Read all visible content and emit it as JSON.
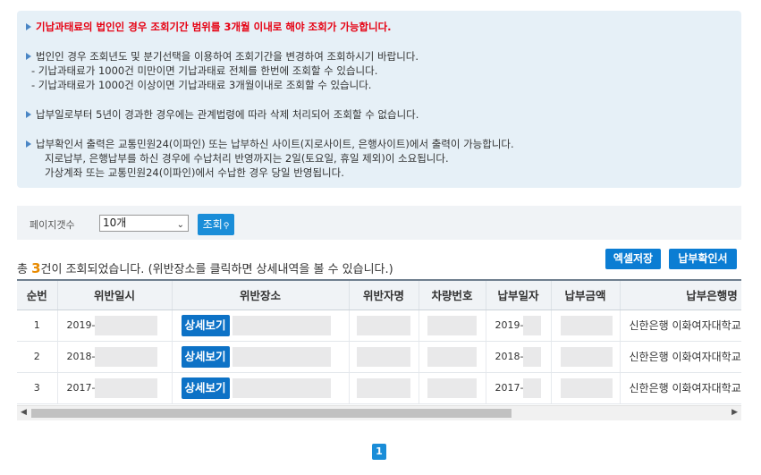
{
  "notice": {
    "line1": "기납과태료의 법인인 경우 조회기간 범위를 3개월 이내로 해야 조회가 가능합니다.",
    "line2": "법인인 경우 조회년도 및 분기선택을 이용하여 조회기간을 변경하여 조회하시기 바랍니다.",
    "line2a": "- 기납과태료가 1000건 미만이면 기납과태료 전체를 한번에 조회할 수 있습니다.",
    "line2b": "- 기납과태료가 1000건 이상이면 기납과태료 3개월이내로 조회할 수 있습니다.",
    "line3": "납부일로부터 5년이 경과한 경우에는 관계법령에 따라 삭제 처리되어 조회할 수 없습니다.",
    "line4": "납부확인서 출력은 교통민원24(이파인) 또는 납부하신 사이트(지로사이트, 은행사이트)에서 출력이 가능합니다.",
    "line4a": "지로납부, 은행납부를 하신 경우에 수납처리 반영까지는 2일(토요일, 휴일 제외)이 소요됩니다.",
    "line4b": "가상계좌 또는 교통민원24(이파인)에서 수납한 경우 당일 반영됩니다."
  },
  "search": {
    "page_count_label": "페이지갯수",
    "page_count_value": "10개",
    "search_label": "조회"
  },
  "result": {
    "prefix": "총 ",
    "count": "3",
    "suffix": "건이 조회되었습니다. (위반장소를 클릭하면 상세내역을 볼 수 있습니다.)"
  },
  "buttons": {
    "excel": "엑셀저장",
    "receipt": "납부확인서"
  },
  "table": {
    "headers": [
      "순번",
      "위반일시",
      "위반장소",
      "위반자명",
      "차량번호",
      "납부일자",
      "납부금액",
      "납부은행명"
    ],
    "detail_label": "상세보기",
    "rows": [
      {
        "no": "1",
        "date": "2019-",
        "paid_date": "2019-",
        "bank": "신한은행 이화여자대학교"
      },
      {
        "no": "2",
        "date": "2018-",
        "paid_date": "2018-",
        "bank": "신한은행 이화여자대학교"
      },
      {
        "no": "3",
        "date": "2017-",
        "paid_date": "2017-",
        "bank": "신한은행 이화여자대학교"
      }
    ]
  },
  "pager": {
    "current": "1"
  }
}
